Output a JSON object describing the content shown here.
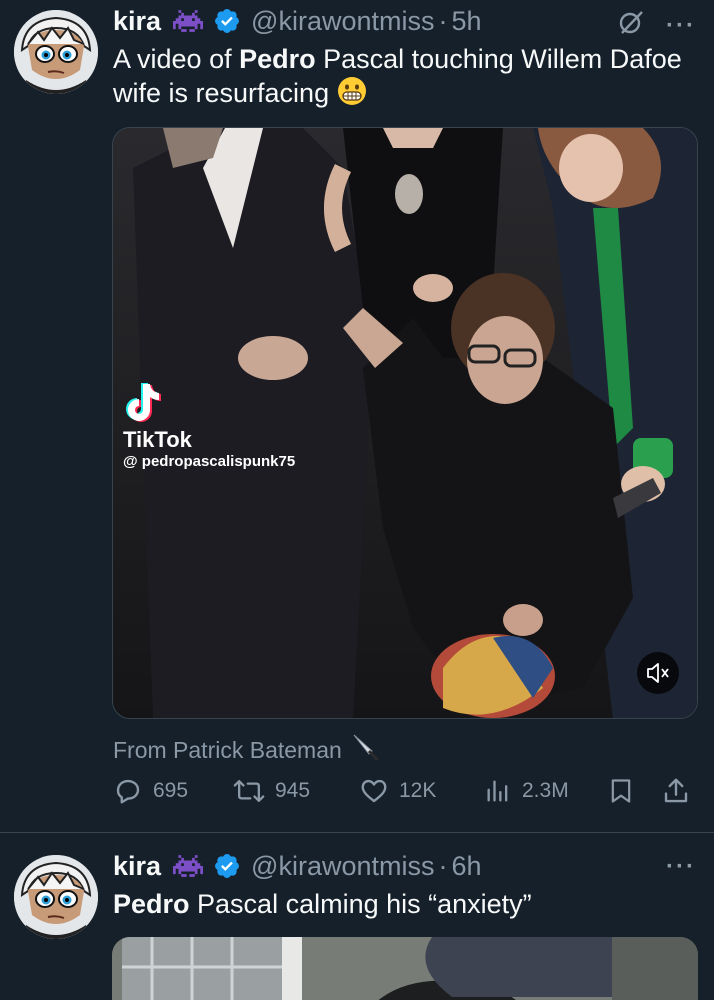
{
  "tweets": [
    {
      "author": {
        "name": "kira",
        "handle": "@kirawontmiss",
        "time": "5h"
      },
      "text_prefix": "A video of ",
      "text_bold": "Pedro",
      "text_rest": " Pascal touching Willem Dafoe wife is resurfacing",
      "video": {
        "watermark_brand": "TikTok",
        "watermark_user": "@ pedropascalispunk75"
      },
      "source": "From Patrick Bateman",
      "actions": {
        "replies": "695",
        "reposts": "945",
        "likes": "12K",
        "views": "2.3M"
      }
    },
    {
      "author": {
        "name": "kira",
        "handle": "@kirawontmiss",
        "time": "6h"
      },
      "text_bold": "Pedro",
      "text_rest": " Pascal calming his “anxiety”"
    }
  ],
  "icons": {
    "verified_color": "#1d9bf0",
    "alien_color": "#7d4fc7",
    "accent_gray": "#8b98a5"
  }
}
